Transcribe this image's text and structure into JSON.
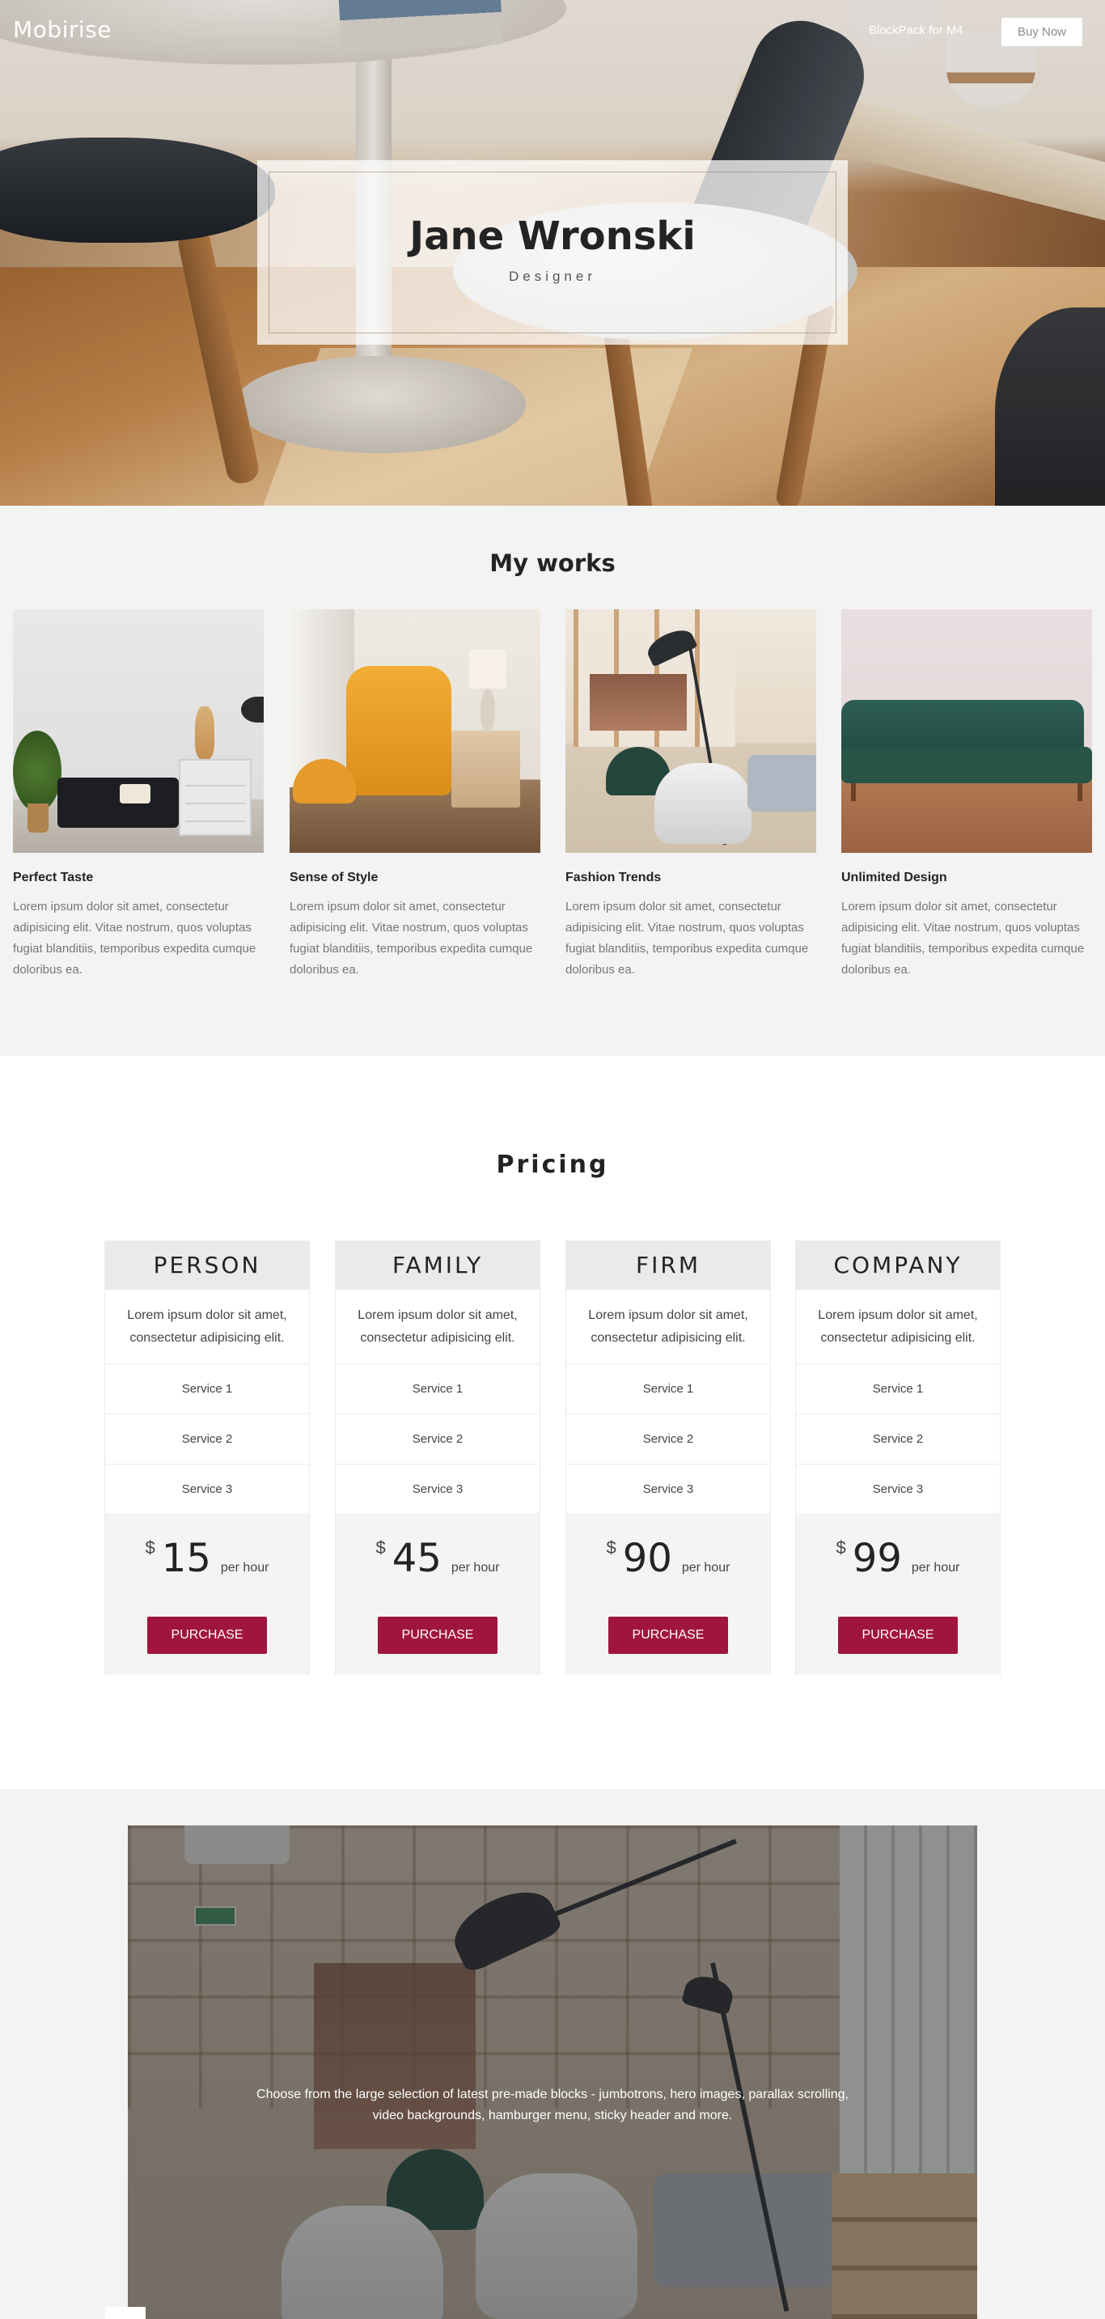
{
  "header": {
    "logo": "Mobirise",
    "nav_link": "BlockPack for M4",
    "buy_button": "Buy Now"
  },
  "hero": {
    "title": "Jane Wronski",
    "subtitle": "Designer"
  },
  "works": {
    "title": "My works",
    "items": [
      {
        "title": "Perfect Taste",
        "text": "Lorem ipsum dolor sit amet, consectetur adipisicing elit. Vitae nostrum, quos voluptas fugiat blanditiis, temporibus expedita cumque doloribus ea."
      },
      {
        "title": "Sense of Style",
        "text": "Lorem ipsum dolor sit amet, consectetur adipisicing elit. Vitae nostrum, quos voluptas fugiat blanditiis, temporibus expedita cumque doloribus ea."
      },
      {
        "title": "Fashion Trends",
        "text": "Lorem ipsum dolor sit amet, consectetur adipisicing elit. Vitae nostrum, quos voluptas fugiat blanditiis, temporibus expedita cumque doloribus ea."
      },
      {
        "title": "Unlimited Design",
        "text": "Lorem ipsum dolor sit amet, consectetur adipisicing elit. Vitae nostrum, quos voluptas fugiat blanditiis, temporibus expedita cumque doloribus ea."
      }
    ]
  },
  "pricing": {
    "title": "Pricing",
    "plans": [
      {
        "name": "PERSON",
        "desc": "Lorem ipsum dolor sit amet, consectetur adipisicing elit.",
        "services": [
          "Service 1",
          "Service 2",
          "Service 3"
        ],
        "currency": "$",
        "price": "15",
        "period": "per hour",
        "button": "PURCHASE"
      },
      {
        "name": "FAMILY",
        "desc": "Lorem ipsum dolor sit amet, consectetur adipisicing elit.",
        "services": [
          "Service 1",
          "Service 2",
          "Service 3"
        ],
        "currency": "$",
        "price": "45",
        "period": "per hour",
        "button": "PURCHASE"
      },
      {
        "name": "FIRM",
        "desc": "Lorem ipsum dolor sit amet, consectetur adipisicing elit.",
        "services": [
          "Service 1",
          "Service 2",
          "Service 3"
        ],
        "currency": "$",
        "price": "90",
        "period": "per hour",
        "button": "PURCHASE"
      },
      {
        "name": "COMPANY",
        "desc": "Lorem ipsum dolor sit amet, consectetur adipisicing elit.",
        "services": [
          "Service 1",
          "Service 2",
          "Service 3"
        ],
        "currency": "$",
        "price": "99",
        "period": "per hour",
        "button": "PURCHASE"
      }
    ]
  },
  "promo": {
    "text": "Choose from the large selection of latest pre-made blocks - jumbotrons, hero images, parallax scrolling, video backgrounds, hamburger menu, sticky header and more."
  },
  "colors": {
    "accent": "#a0153e",
    "section_gray": "#f3f3f3",
    "plan_header": "#eaeaea"
  }
}
